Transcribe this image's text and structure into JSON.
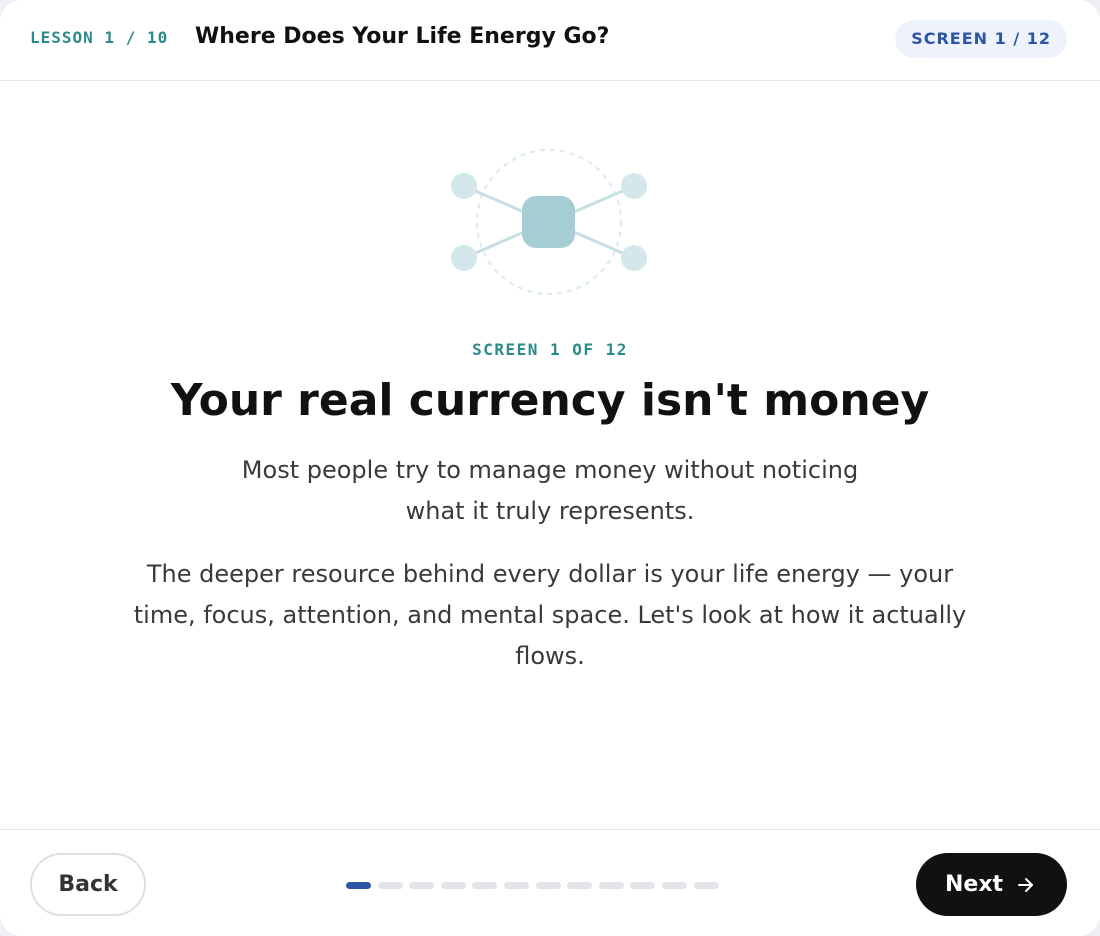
{
  "header": {
    "lesson_label": "LESSON 1 / 10",
    "title": "Where Does Your Life Energy Go?",
    "screen_badge": "SCREEN 1 / 12"
  },
  "illustration": {
    "icon": "network-hub-icon",
    "center_color": "#a6cdd3",
    "node_color": "#d4e7ea",
    "line_color": "#c6dfe2",
    "ring_color": "#d8ebee"
  },
  "content": {
    "eyebrow": "SCREEN 1 OF 12",
    "headline": "Your real currency isn't money",
    "paragraph1": "Most people try to manage money without noticing what it truly represents.",
    "paragraph2": "The deeper resource behind every dollar is your life energy — your time, focus, attention, and mental space. Let's look at how it actually flows."
  },
  "footer": {
    "back_label": "Back",
    "next_label": "Next",
    "next_icon": "arrow-right-icon",
    "progress": {
      "current": 1,
      "total": 12
    }
  },
  "colors": {
    "accent_teal": "#2b8a8a",
    "accent_blue": "#2e55a4",
    "primary_button": "#111111"
  }
}
